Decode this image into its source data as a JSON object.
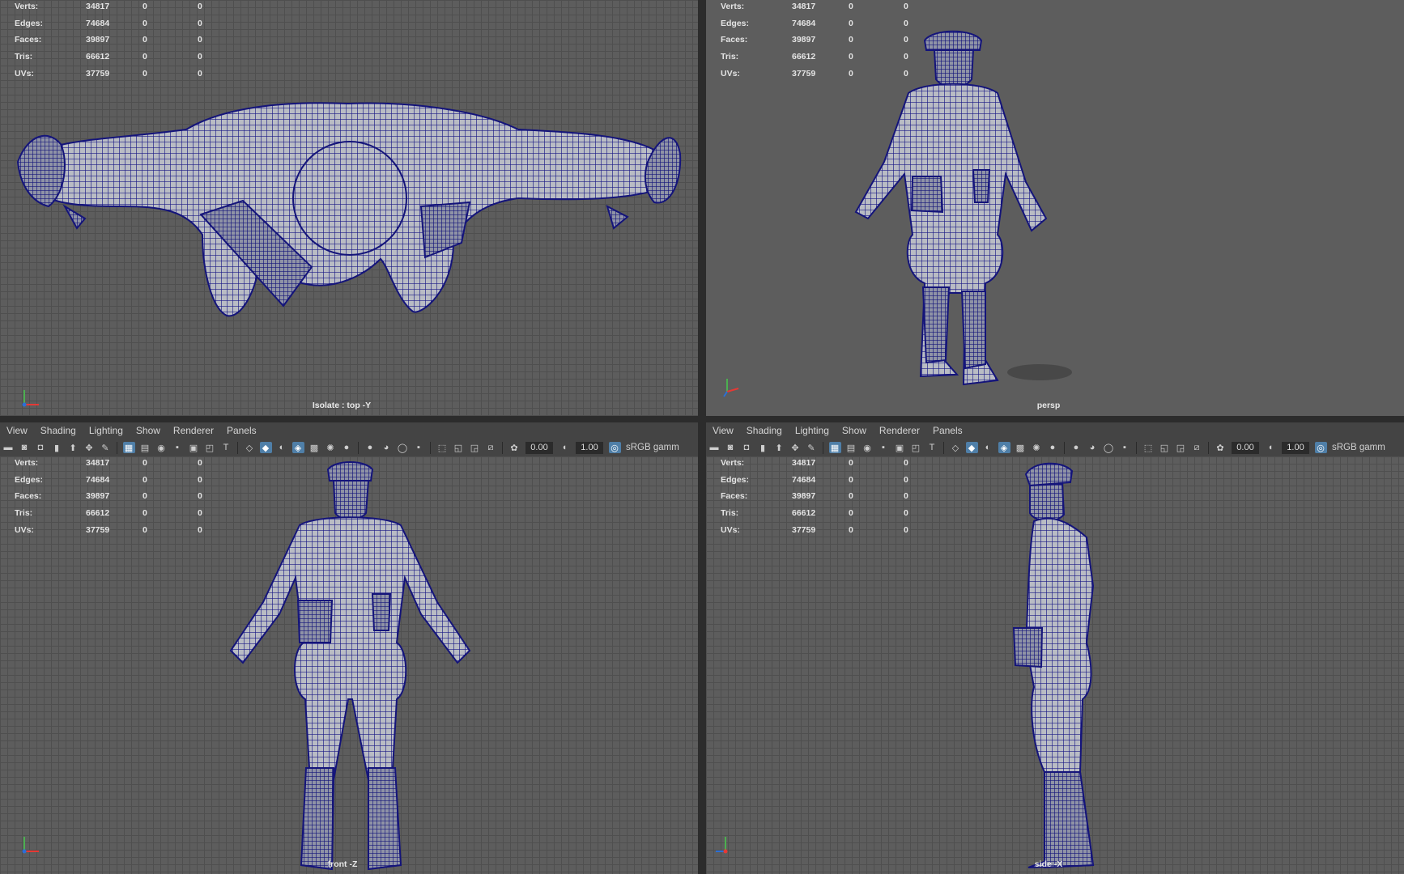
{
  "stats": {
    "rows": [
      {
        "label": "Verts:",
        "v1": "34817",
        "v2": "0",
        "v3": "0"
      },
      {
        "label": "Edges:",
        "v1": "74684",
        "v2": "0",
        "v3": "0"
      },
      {
        "label": "Faces:",
        "v1": "39897",
        "v2": "0",
        "v3": "0"
      },
      {
        "label": "Tris:",
        "v1": "66612",
        "v2": "0",
        "v3": "0"
      },
      {
        "label": "UVs:",
        "v1": "37759",
        "v2": "0",
        "v3": "0"
      }
    ]
  },
  "viewports": {
    "top": {
      "camera_label": "Isolate : top -Y"
    },
    "persp": {
      "camera_label": "persp"
    },
    "front": {
      "camera_label": "front -Z"
    },
    "side": {
      "camera_label": "side -X"
    }
  },
  "panel_menu": [
    "View",
    "Shading",
    "Lighting",
    "Show",
    "Renderer",
    "Panels"
  ],
  "toolbar": {
    "exposure": "0.00",
    "gamma": "1.00",
    "color_space": "sRGB gamm"
  },
  "colors": {
    "wire": "#1a1a86",
    "mesh_fill": "#b9bcc4",
    "viewport_bg": "#5d5d5d",
    "active_button": "#4f7fa8"
  },
  "icons": [
    "camera-icon",
    "grid-icon",
    "wireframe-icon",
    "smooth-shade-icon",
    "light-icon",
    "isolate-icon",
    "exposure-icon",
    "gamma-icon",
    "color-management-icon"
  ]
}
